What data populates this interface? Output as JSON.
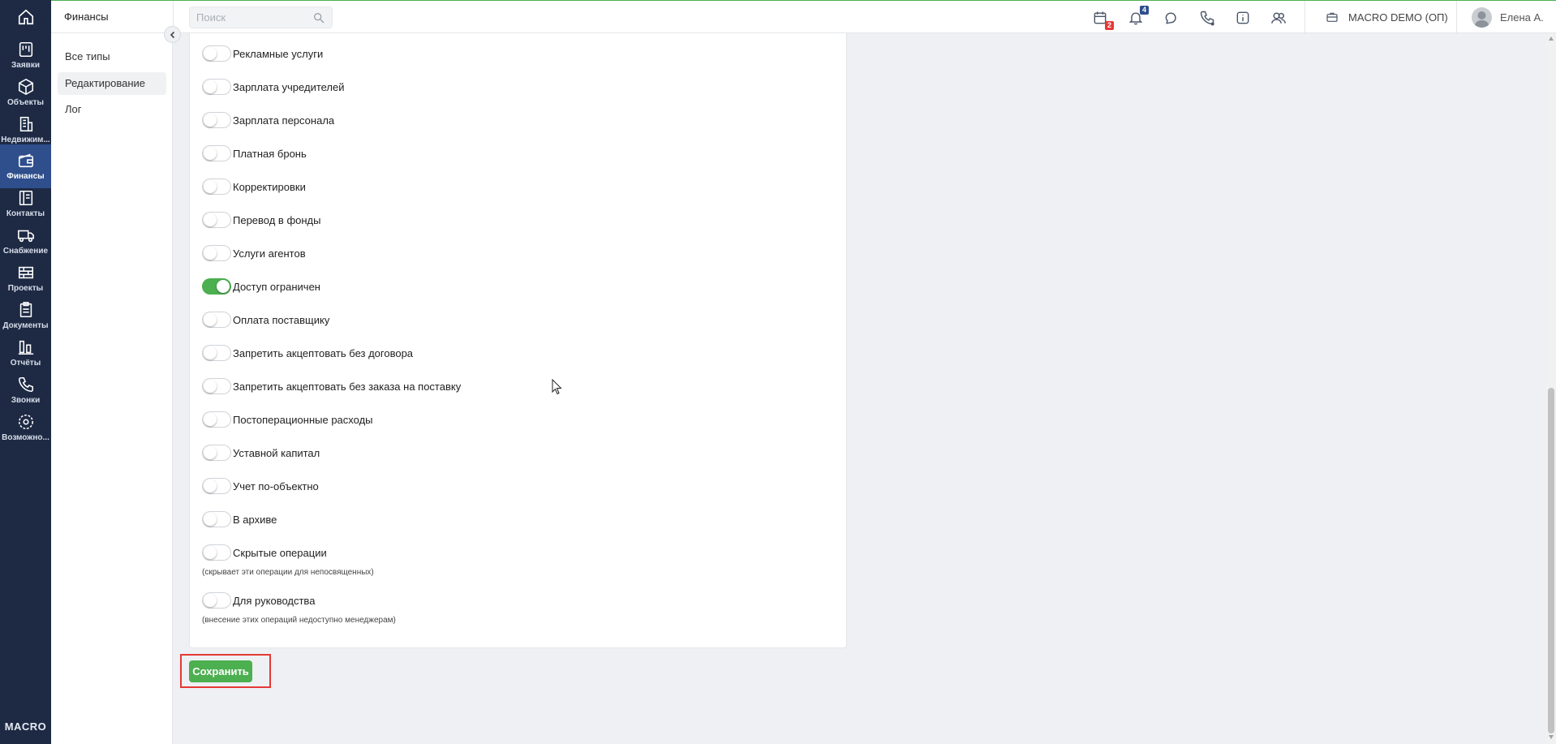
{
  "nav": {
    "items": [
      {
        "label": "Заявки",
        "icon": "requests-icon"
      },
      {
        "label": "Объекты",
        "icon": "cube-icon"
      },
      {
        "label": "Недвижим...",
        "icon": "building-icon"
      },
      {
        "label": "Финансы",
        "icon": "wallet-icon",
        "active": true
      },
      {
        "label": "Контакты",
        "icon": "contacts-icon"
      },
      {
        "label": "Снабжение",
        "icon": "truck-icon"
      },
      {
        "label": "Проекты",
        "icon": "bricks-icon"
      },
      {
        "label": "Документы",
        "icon": "clipboard-icon"
      },
      {
        "label": "Отчёты",
        "icon": "bar-chart-icon"
      },
      {
        "label": "Звонки",
        "icon": "phone-icon"
      },
      {
        "label": "Возможно...",
        "icon": "gear-icon"
      }
    ],
    "brand": "MACRO"
  },
  "header": {
    "section_title": "Финансы",
    "search_placeholder": "Поиск",
    "calendar_badge": "2",
    "notifications_badge": "4",
    "company": "MACRO DEMO (ОП)",
    "user": "Елена А."
  },
  "submenu": {
    "items": [
      {
        "label": "Все типы"
      },
      {
        "label": "Редактирование",
        "active": true
      },
      {
        "label": "Лог"
      }
    ]
  },
  "toggles": [
    {
      "label": "Рекламные услуги",
      "on": false
    },
    {
      "label": "Зарплата учредителей",
      "on": false
    },
    {
      "label": "Зарплата персонала",
      "on": false
    },
    {
      "label": "Платная бронь",
      "on": false
    },
    {
      "label": "Корректировки",
      "on": false
    },
    {
      "label": "Перевод в фонды",
      "on": false
    },
    {
      "label": "Услуги агентов",
      "on": false
    },
    {
      "label": "Доступ ограничен",
      "on": true
    },
    {
      "label": "Оплата поставщику",
      "on": false
    },
    {
      "label": "Запретить акцептовать без договора",
      "on": false
    },
    {
      "label": "Запретить акцептовать без заказа на поставку",
      "on": false
    },
    {
      "label": "Постоперационные расходы",
      "on": false
    },
    {
      "label": "Уставной капитал",
      "on": false
    },
    {
      "label": "Учет по-объектно",
      "on": false
    },
    {
      "label": "В архиве",
      "on": false
    },
    {
      "label": "Скрытые операции",
      "on": false,
      "hint": "(скрывает эти операции для непосвященных)"
    },
    {
      "label": "Для руководства",
      "on": false,
      "hint": "(внесение этих операций недоступно менеджерам)"
    }
  ],
  "actions": {
    "save_label": "Сохранить"
  },
  "colors": {
    "nav_bg": "#1e2a44",
    "nav_active": "#2e4e8c",
    "accent_green": "#4caf50",
    "highlight_red": "#e53935"
  }
}
